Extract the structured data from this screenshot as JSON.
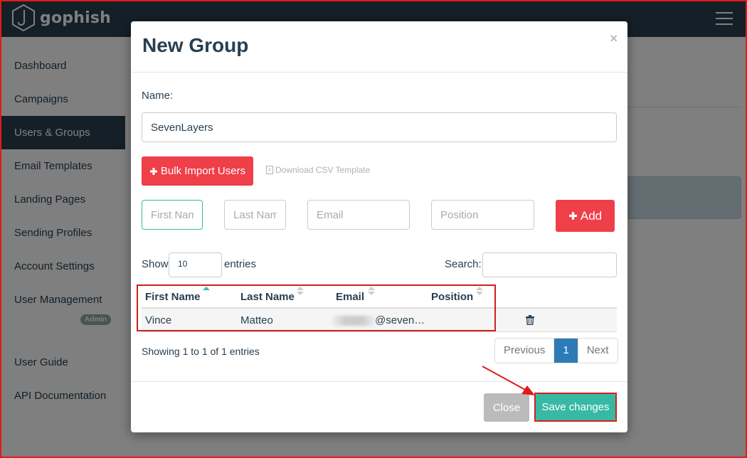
{
  "app": {
    "brand": "gophish"
  },
  "sidebar": {
    "items": [
      {
        "label": "Dashboard",
        "active": false
      },
      {
        "label": "Campaigns",
        "active": false
      },
      {
        "label": "Users & Groups",
        "active": true
      },
      {
        "label": "Email Templates",
        "active": false
      },
      {
        "label": "Landing Pages",
        "active": false
      },
      {
        "label": "Sending Profiles",
        "active": false
      },
      {
        "label": "Account Settings",
        "active": false
      },
      {
        "label": "User Management",
        "active": false
      },
      {
        "label": "User Guide",
        "active": false
      },
      {
        "label": "API Documentation",
        "active": false
      }
    ],
    "admin_badge": "Admin"
  },
  "modal": {
    "title": "New Group",
    "close_symbol": "×",
    "name_label": "Name:",
    "name_value": "SevenLayers",
    "bulk_import_label": "Bulk Import Users",
    "csv_template_label": "Download CSV Template",
    "placeholders": {
      "first_name": "First Name",
      "last_name": "Last Name",
      "email": "Email",
      "position": "Position"
    },
    "add_label": "Add",
    "show_label": "Show",
    "show_value": "10",
    "entries_label": "entries",
    "search_label": "Search:",
    "table": {
      "headers": [
        "First Name",
        "Last Name",
        "Email",
        "Position"
      ],
      "rows": [
        {
          "first_name": "Vince",
          "last_name": "Matteo",
          "email": "@seven…",
          "position": ""
        }
      ]
    },
    "showing_text": "Showing 1 to 1 of 1 entries",
    "pagination": {
      "previous": "Previous",
      "current": "1",
      "next": "Next"
    },
    "footer": {
      "close_label": "Close",
      "save_label": "Save changes"
    }
  },
  "colors": {
    "navbar": "#283f50",
    "danger": "#ef3f49",
    "primary": "#37b9a4",
    "pagination_active": "#2d7bb6",
    "annotation": "#d11f1f"
  },
  "icons": {
    "plus": "plus-icon",
    "trash": "trash-icon",
    "file": "file-csv-icon",
    "menu": "hamburger-icon",
    "logo": "hook-hexagon-icon"
  }
}
